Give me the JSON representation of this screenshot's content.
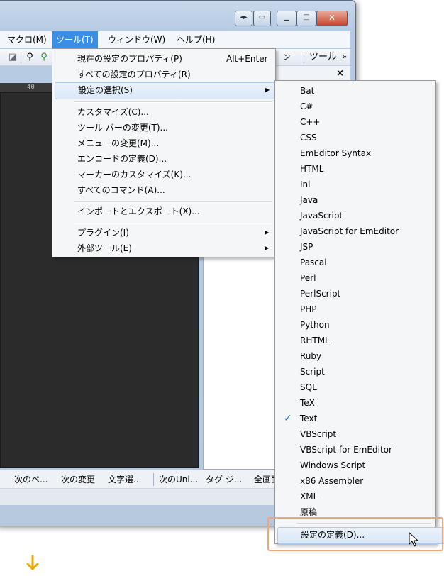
{
  "menubar": {
    "items": [
      "マクロ(M)",
      "ツール(T)",
      "ウィンドウ(W)",
      "ヘルプ(H)"
    ],
    "active_index": 1
  },
  "toolbar": {
    "overflow": "»",
    "panel_label": "ツール",
    "panel_overflow": "»",
    "separator_label": "ン"
  },
  "ruler": {
    "label": "40"
  },
  "tools_menu": {
    "items": [
      {
        "label": "現在の設定のプロパティ(P)",
        "shortcut": "Alt+Enter"
      },
      {
        "label": "すべての設定のプロパティ(R)"
      },
      {
        "label": "設定の選択(S)",
        "submenu": true,
        "highlighted": true
      },
      {
        "label": "カスタマイズ(C)..."
      },
      {
        "label": "ツール バーの変更(T)..."
      },
      {
        "label": "メニューの変更(M)..."
      },
      {
        "label": "エンコードの定義(D)..."
      },
      {
        "label": "マーカーのカスタマイズ(K)..."
      },
      {
        "label": "すべてのコマンド(A)..."
      },
      {
        "label": "インポートとエクスポート(X)..."
      },
      {
        "label": "プラグイン(I)",
        "submenu": true
      },
      {
        "label": "外部ツール(E)",
        "submenu": true
      }
    ]
  },
  "syntax_menu": {
    "items": [
      "Bat",
      "C#",
      "C++",
      "CSS",
      "EmEditor Syntax",
      "HTML",
      "Ini",
      "Java",
      "JavaScript",
      "JavaScript for EmEditor",
      "JSP",
      "Pascal",
      "Perl",
      "PerlScript",
      "PHP",
      "Python",
      "RHTML",
      "Ruby",
      "Script",
      "SQL",
      "TeX",
      "Text",
      "VBScript",
      "VBScript for EmEditor",
      "Windows Script",
      "x86 Assembler",
      "XML",
      "原稿"
    ],
    "checked": "Text",
    "define": "設定の定義(D)..."
  },
  "statusbar": {
    "items": [
      "次のペ...",
      "次の変更",
      "文字選...",
      "次のUni...",
      "タグ ジ...",
      "全画面"
    ]
  },
  "colors": {
    "menu_active": "#3a8ee6",
    "highlight_border": "#f2a47b",
    "arrow": "#f0a800",
    "check": "#2a6fc9"
  }
}
